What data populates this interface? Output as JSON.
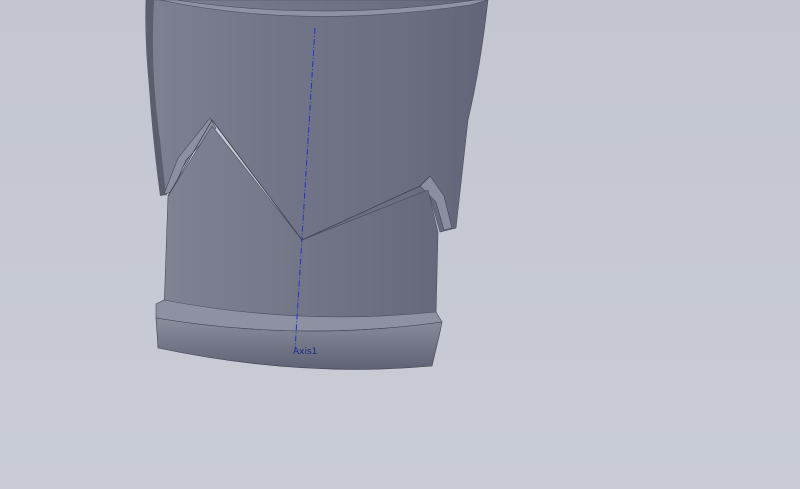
{
  "viewport": {
    "background": "#c6c9d4"
  },
  "model": {
    "body_color": "#6f7384",
    "shade_color": "#5d6172",
    "highlight_color": "#8a8e9e",
    "edge_color": "#3f4250"
  },
  "axis": {
    "label": "Axis1",
    "color": "#2233cc"
  }
}
